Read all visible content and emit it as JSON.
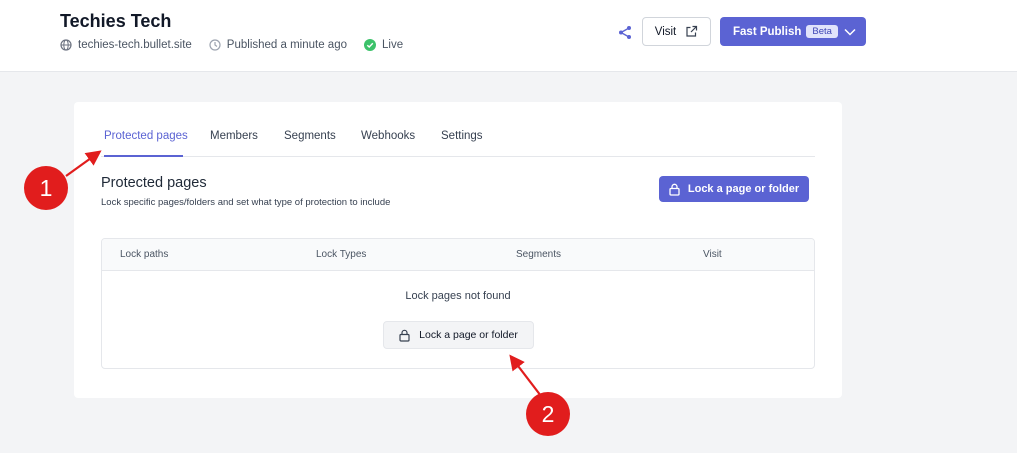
{
  "header": {
    "title": "Techies Tech",
    "domain": "techies-tech.bullet.site",
    "published": "Published a minute ago",
    "status": "Live",
    "status_color": "#3cc26a",
    "share_icon": "share-icon",
    "visit_label": "Visit",
    "publish_label": "Fast Publish",
    "beta_label": "Beta",
    "accent": "#5b63d3"
  },
  "tabs": [
    {
      "label": "Protected pages",
      "active": true
    },
    {
      "label": "Members",
      "active": false
    },
    {
      "label": "Segments",
      "active": false
    },
    {
      "label": "Webhooks",
      "active": false
    },
    {
      "label": "Settings",
      "active": false
    }
  ],
  "section": {
    "title": "Protected pages",
    "subtitle": "Lock specific pages/folders and set what type of protection to include",
    "lock_button": "Lock a page or folder"
  },
  "table": {
    "columns": [
      "Lock paths",
      "Lock Types",
      "Segments",
      "Visit"
    ],
    "empty_text": "Lock pages not found",
    "empty_button": "Lock a page or folder"
  },
  "annotations": [
    {
      "label": "1",
      "color": "#e11d1d"
    },
    {
      "label": "2",
      "color": "#e11d1d"
    }
  ]
}
